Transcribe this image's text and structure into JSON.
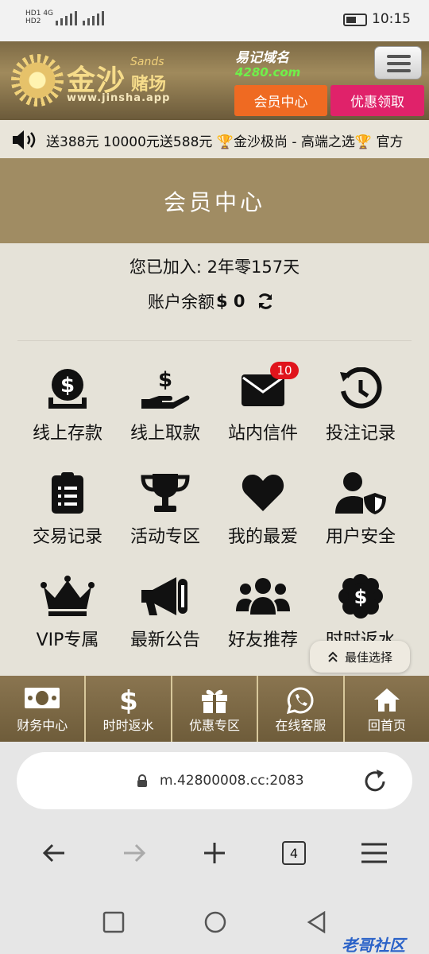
{
  "status_bar": {
    "sim1": "HD1",
    "sim2": "HD2",
    "net1": "4G",
    "net2": "4G",
    "time": "10:15"
  },
  "header": {
    "logo_name": "金沙",
    "logo_sands": "Sands",
    "logo_sub": "赌场",
    "logo_url": "www.jinsha.app",
    "domain_title": "易记域名",
    "domain_value": "4280.com",
    "member_center_button": "会员中心",
    "promo_button": "优惠领取"
  },
  "marquee": {
    "text": "送388元   10000元送588元  🏆金沙极尚 - 高端之选🏆  官方"
  },
  "page": {
    "title": "会员中心",
    "joined": "您已加入: 2年零157天",
    "balance_label": "账户余额",
    "balance_value": "$ 0"
  },
  "grid": [
    {
      "label": "线上存款",
      "icon": "deposit-icon"
    },
    {
      "label": "线上取款",
      "icon": "withdraw-icon"
    },
    {
      "label": "站内信件",
      "icon": "mail-icon"
    },
    {
      "label": "投注记录",
      "icon": "history-icon"
    },
    {
      "label": "交易记录",
      "icon": "clipboard-icon"
    },
    {
      "label": "活动专区",
      "icon": "trophy-icon"
    },
    {
      "label": "我的最爱",
      "icon": "heart-icon"
    },
    {
      "label": "用户安全",
      "icon": "user-shield-icon"
    },
    {
      "label": "VIP专属",
      "icon": "crown-icon"
    },
    {
      "label": "最新公告",
      "icon": "megaphone-icon"
    },
    {
      "label": "好友推荐",
      "icon": "users-icon"
    },
    {
      "label": "时时返水",
      "icon": "dollar-badge-icon"
    }
  ],
  "mail_badge": "10",
  "best_choice": "最佳选择",
  "bottom_nav": [
    {
      "label": "财务中心",
      "icon": "money-icon"
    },
    {
      "label": "时时返水",
      "icon": "dollar-icon"
    },
    {
      "label": "优惠专区",
      "icon": "gift-icon"
    },
    {
      "label": "在线客服",
      "icon": "whatsapp-icon"
    },
    {
      "label": "回首页",
      "icon": "home-icon"
    }
  ],
  "browser": {
    "url": "m.42800008.cc:2083",
    "tab_count": "4"
  },
  "watermark": "老哥社区",
  "colors": {
    "header_gold": "#a08a5c",
    "member_orange": "#ef6a22",
    "promo_pink": "#e0226a",
    "badge_red": "#e0141c",
    "page_bg": "#e5e2d8"
  }
}
